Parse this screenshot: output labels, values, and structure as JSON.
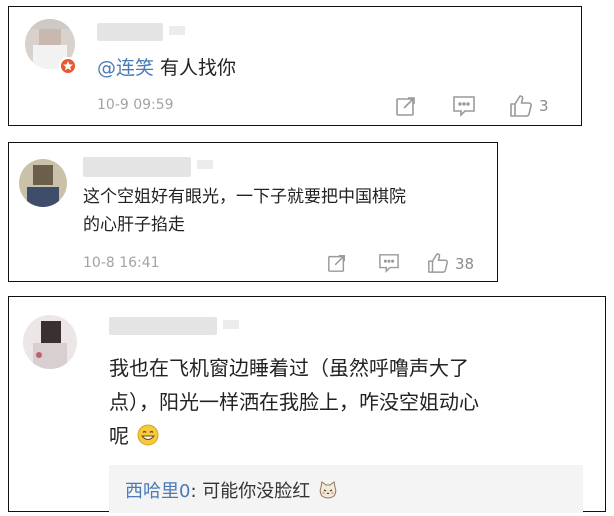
{
  "comments": [
    {
      "username": "",
      "mention": "@连笑",
      "text": " 有人找你",
      "timestamp": "10-9 09:59",
      "like_count": "3",
      "icons": [
        "repost-icon",
        "reply-comment-icon",
        "thumbs-up-icon"
      ]
    },
    {
      "username": "",
      "text_line1": "这个空姐好有眼光，一下子就要把中国棋院",
      "text_line2": "的心肝子掐走",
      "timestamp": "10-8 16:41",
      "like_count": "38",
      "icons": [
        "repost-icon",
        "reply-comment-icon",
        "thumbs-up-icon"
      ]
    },
    {
      "username": "",
      "text_line1": "我也在飞机窗边睡着过（虽然呼噜声大了",
      "text_line2": "点），阳光一样洒在我脸上，咋没空姐动心",
      "text_line3": "呢",
      "reply": {
        "name": "西哈里0",
        "text": ": 可能你没脸红"
      }
    }
  ],
  "colors": {
    "link": "#4a7ab8",
    "meta": "#a3a3a3",
    "icon": "#9a9a9a"
  }
}
